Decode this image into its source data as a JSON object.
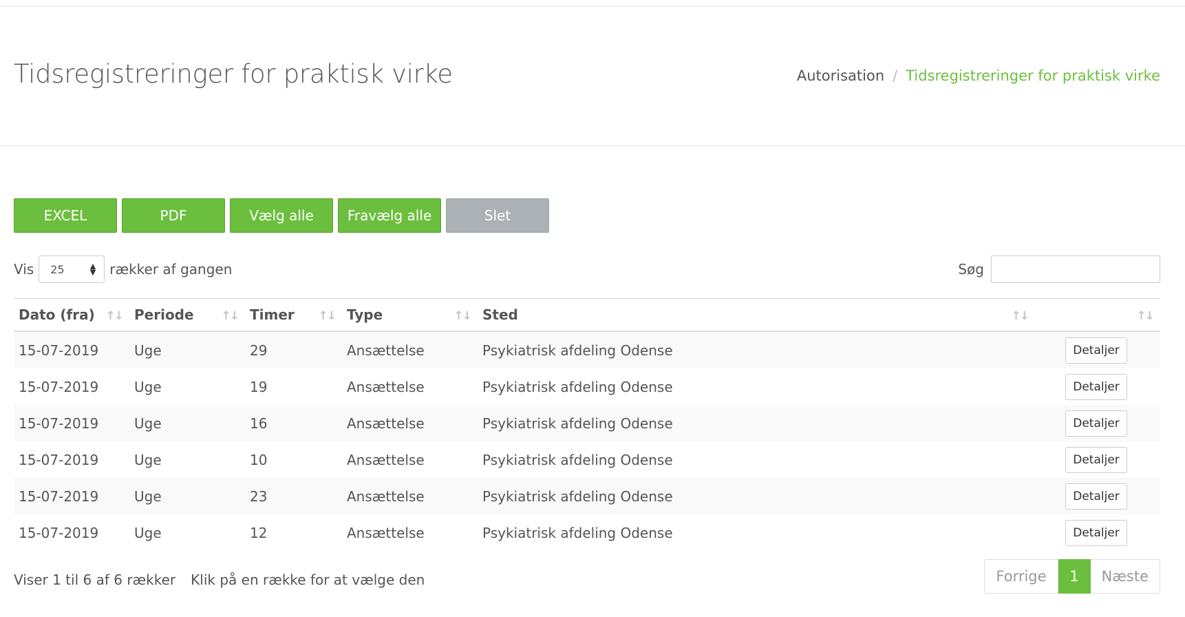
{
  "header": {
    "title": "Tidsregistreringer for praktisk virke",
    "breadcrumb": {
      "parent": "Autorisation",
      "separator": "/",
      "current": "Tidsregistreringer for praktisk virke"
    }
  },
  "toolbar": {
    "excel_label": "EXCEL",
    "pdf_label": "PDF",
    "select_all_label": "Vælg alle",
    "deselect_all_label": "Fravælg alle",
    "delete_label": "Slet"
  },
  "length": {
    "prefix": "Vis",
    "value": "25",
    "suffix": "rækker af gangen"
  },
  "search": {
    "label": "Søg",
    "value": ""
  },
  "table": {
    "columns": [
      "Dato (fra)",
      "Periode",
      "Timer",
      "Type",
      "Sted",
      ""
    ],
    "rows": [
      {
        "date": "15-07-2019",
        "period": "Uge",
        "hours": "29",
        "type": "Ansættelse",
        "place": "Psykiatrisk afdeling Odense",
        "action": "Detaljer"
      },
      {
        "date": "15-07-2019",
        "period": "Uge",
        "hours": "19",
        "type": "Ansættelse",
        "place": "Psykiatrisk afdeling Odense",
        "action": "Detaljer"
      },
      {
        "date": "15-07-2019",
        "period": "Uge",
        "hours": "16",
        "type": "Ansættelse",
        "place": "Psykiatrisk afdeling Odense",
        "action": "Detaljer"
      },
      {
        "date": "15-07-2019",
        "period": "Uge",
        "hours": "10",
        "type": "Ansættelse",
        "place": "Psykiatrisk afdeling Odense",
        "action": "Detaljer"
      },
      {
        "date": "15-07-2019",
        "period": "Uge",
        "hours": "23",
        "type": "Ansættelse",
        "place": "Psykiatrisk afdeling Odense",
        "action": "Detaljer"
      },
      {
        "date": "15-07-2019",
        "period": "Uge",
        "hours": "12",
        "type": "Ansættelse",
        "place": "Psykiatrisk afdeling Odense",
        "action": "Detaljer"
      }
    ]
  },
  "footer": {
    "info": "Viser 1 til 6 af 6 rækker",
    "hint": "Klik på en række for at vælge den"
  },
  "pagination": {
    "previous": "Forrige",
    "current": "1",
    "next": "Næste"
  },
  "colors": {
    "accent": "#6cbf3e",
    "disabled": "#acb1b5",
    "text": "#555555"
  }
}
